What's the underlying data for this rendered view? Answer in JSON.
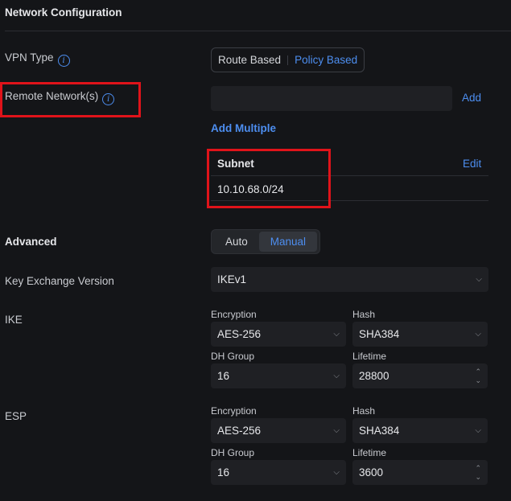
{
  "section_title": "Network Configuration",
  "vpn_type": {
    "label": "VPN Type",
    "options": [
      "Route Based",
      "Policy Based"
    ],
    "selected": "Policy Based"
  },
  "remote_networks": {
    "label": "Remote Network(s)",
    "input_value": "",
    "add_label": "Add",
    "add_multiple_label": "Add Multiple",
    "table": {
      "header": "Subnet",
      "edit_label": "Edit",
      "rows": [
        "10.10.68.0/24"
      ]
    }
  },
  "advanced": {
    "label": "Advanced",
    "options": [
      "Auto",
      "Manual"
    ],
    "selected": "Manual"
  },
  "key_exchange": {
    "label": "Key Exchange Version",
    "value": "IKEv1"
  },
  "ike": {
    "label": "IKE",
    "encryption_label": "Encryption",
    "encryption": "AES-256",
    "hash_label": "Hash",
    "hash": "SHA384",
    "dh_label": "DH Group",
    "dh": "16",
    "lifetime_label": "Lifetime",
    "lifetime": "28800"
  },
  "esp": {
    "label": "ESP",
    "encryption_label": "Encryption",
    "encryption": "AES-256",
    "hash_label": "Hash",
    "hash": "SHA384",
    "dh_label": "DH Group",
    "dh": "16",
    "lifetime_label": "Lifetime",
    "lifetime": "3600"
  },
  "colors": {
    "accent": "#4d8ef0",
    "highlight": "#e0131a",
    "background": "#141518"
  },
  "icons": {
    "info": "info-icon",
    "chevron": "chevron-down-icon",
    "stepper": "up-down-stepper-icon"
  }
}
